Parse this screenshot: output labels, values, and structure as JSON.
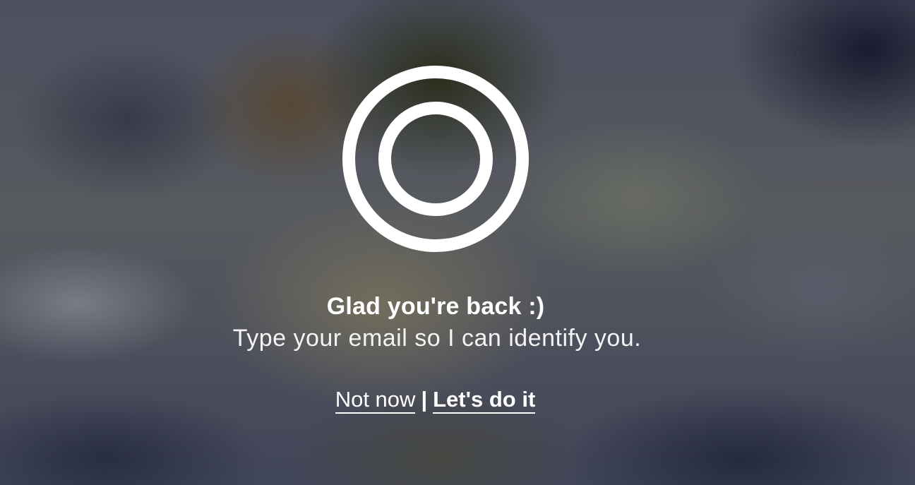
{
  "logo": {
    "icon": "concentric-rings-icon",
    "color": "#ffffff"
  },
  "prompt": {
    "heading": "Glad you're back :)",
    "message": "Type your email so I can identify you."
  },
  "actions": {
    "decline_label": "Not now",
    "separator": "|",
    "accept_label": "Let's do it"
  },
  "colors": {
    "text": "#ffffff"
  }
}
